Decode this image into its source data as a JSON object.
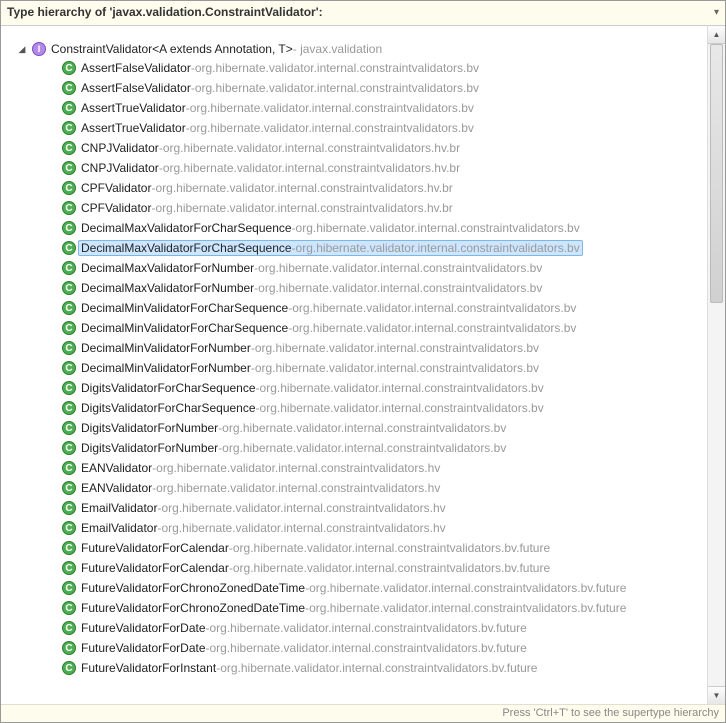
{
  "header": {
    "title": "Type hierarchy of 'javax.validation.ConstraintValidator':"
  },
  "root": {
    "name": "ConstraintValidator",
    "generics": "<A extends Annotation, T>",
    "pkg": "javax.validation"
  },
  "items": [
    {
      "name": "AssertFalseValidator",
      "pkg": "org.hibernate.validator.internal.constraintvalidators.bv",
      "selected": false
    },
    {
      "name": "AssertFalseValidator",
      "pkg": "org.hibernate.validator.internal.constraintvalidators.bv",
      "selected": false
    },
    {
      "name": "AssertTrueValidator",
      "pkg": "org.hibernate.validator.internal.constraintvalidators.bv",
      "selected": false
    },
    {
      "name": "AssertTrueValidator",
      "pkg": "org.hibernate.validator.internal.constraintvalidators.bv",
      "selected": false
    },
    {
      "name": "CNPJValidator",
      "pkg": "org.hibernate.validator.internal.constraintvalidators.hv.br",
      "selected": false
    },
    {
      "name": "CNPJValidator",
      "pkg": "org.hibernate.validator.internal.constraintvalidators.hv.br",
      "selected": false
    },
    {
      "name": "CPFValidator",
      "pkg": "org.hibernate.validator.internal.constraintvalidators.hv.br",
      "selected": false
    },
    {
      "name": "CPFValidator",
      "pkg": "org.hibernate.validator.internal.constraintvalidators.hv.br",
      "selected": false
    },
    {
      "name": "DecimalMaxValidatorForCharSequence",
      "pkg": "org.hibernate.validator.internal.constraintvalidators.bv",
      "selected": false
    },
    {
      "name": "DecimalMaxValidatorForCharSequence",
      "pkg": "org.hibernate.validator.internal.constraintvalidators.bv",
      "selected": true
    },
    {
      "name": "DecimalMaxValidatorForNumber",
      "pkg": "org.hibernate.validator.internal.constraintvalidators.bv",
      "selected": false
    },
    {
      "name": "DecimalMaxValidatorForNumber",
      "pkg": "org.hibernate.validator.internal.constraintvalidators.bv",
      "selected": false
    },
    {
      "name": "DecimalMinValidatorForCharSequence",
      "pkg": "org.hibernate.validator.internal.constraintvalidators.bv",
      "selected": false
    },
    {
      "name": "DecimalMinValidatorForCharSequence",
      "pkg": "org.hibernate.validator.internal.constraintvalidators.bv",
      "selected": false
    },
    {
      "name": "DecimalMinValidatorForNumber",
      "pkg": "org.hibernate.validator.internal.constraintvalidators.bv",
      "selected": false
    },
    {
      "name": "DecimalMinValidatorForNumber",
      "pkg": "org.hibernate.validator.internal.constraintvalidators.bv",
      "selected": false
    },
    {
      "name": "DigitsValidatorForCharSequence",
      "pkg": "org.hibernate.validator.internal.constraintvalidators.bv",
      "selected": false
    },
    {
      "name": "DigitsValidatorForCharSequence",
      "pkg": "org.hibernate.validator.internal.constraintvalidators.bv",
      "selected": false
    },
    {
      "name": "DigitsValidatorForNumber",
      "pkg": "org.hibernate.validator.internal.constraintvalidators.bv",
      "selected": false
    },
    {
      "name": "DigitsValidatorForNumber",
      "pkg": "org.hibernate.validator.internal.constraintvalidators.bv",
      "selected": false
    },
    {
      "name": "EANValidator",
      "pkg": "org.hibernate.validator.internal.constraintvalidators.hv",
      "selected": false
    },
    {
      "name": "EANValidator",
      "pkg": "org.hibernate.validator.internal.constraintvalidators.hv",
      "selected": false
    },
    {
      "name": "EmailValidator",
      "pkg": "org.hibernate.validator.internal.constraintvalidators.hv",
      "selected": false
    },
    {
      "name": "EmailValidator",
      "pkg": "org.hibernate.validator.internal.constraintvalidators.hv",
      "selected": false
    },
    {
      "name": "FutureValidatorForCalendar",
      "pkg": "org.hibernate.validator.internal.constraintvalidators.bv.future",
      "selected": false
    },
    {
      "name": "FutureValidatorForCalendar",
      "pkg": "org.hibernate.validator.internal.constraintvalidators.bv.future",
      "selected": false
    },
    {
      "name": "FutureValidatorForChronoZonedDateTime",
      "pkg": "org.hibernate.validator.internal.constraintvalidators.bv.future",
      "selected": false
    },
    {
      "name": "FutureValidatorForChronoZonedDateTime",
      "pkg": "org.hibernate.validator.internal.constraintvalidators.bv.future",
      "selected": false
    },
    {
      "name": "FutureValidatorForDate",
      "pkg": "org.hibernate.validator.internal.constraintvalidators.bv.future",
      "selected": false
    },
    {
      "name": "FutureValidatorForDate",
      "pkg": "org.hibernate.validator.internal.constraintvalidators.bv.future",
      "selected": false
    },
    {
      "name": "FutureValidatorForInstant",
      "pkg": "org.hibernate.validator.internal.constraintvalidators.bv.future",
      "selected": false
    }
  ],
  "footer": {
    "hint": "Press 'Ctrl+T' to see the supertype hierarchy"
  }
}
